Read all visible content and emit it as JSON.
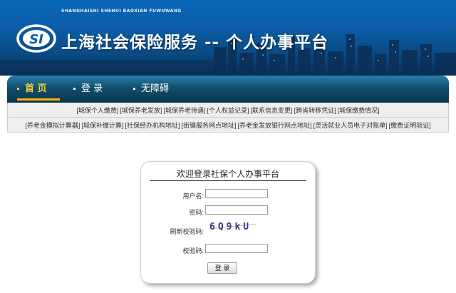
{
  "banner": {
    "pinyin": "SHANGHAISHI SHEHUI BAOXIAN FUWUWANG",
    "title": "上海社会保险服务 -- 个人办事平台",
    "logo_text": "SI"
  },
  "nav": {
    "home": "首 页",
    "login": "登 录",
    "no_barrier": "无障碍"
  },
  "links_row1": [
    "城保个人缴费",
    "城保养老发放",
    "城保养老待遇",
    "个人权益记录",
    "联系信息变更",
    "跨省转移凭证",
    "城保缴费情况"
  ],
  "links_row2": [
    "养老金模拟计算器",
    "城保补缴计算",
    "社保经办机构地址",
    "街镇服务网点地址",
    "养老金发放银行网点地址",
    "灵活就业人员电子对账单",
    "缴费证明验证"
  ],
  "login": {
    "title": "欢迎登录社保个人办事平台",
    "username_label": "用户名:",
    "password_label": "密码:",
    "refresh_captcha_label": "刷新校验码:",
    "captcha_text": "6Q9kU",
    "verify_label": "校验码:",
    "submit": "登 录"
  },
  "colors": {
    "banner_blue": "#0a5ea8",
    "nav_dark": "#08364d",
    "active_nav": "#ffcc33",
    "captcha_purple": "#4b2d86"
  }
}
